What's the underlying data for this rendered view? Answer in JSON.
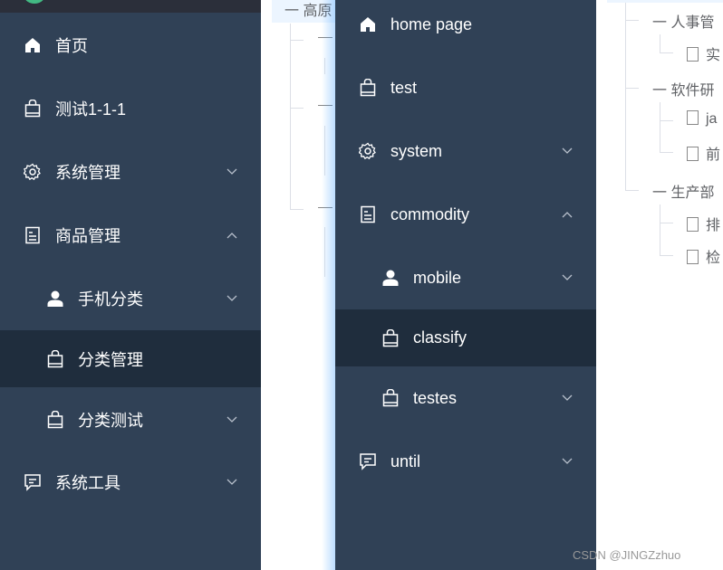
{
  "left_menu": {
    "items": [
      {
        "label": "首页",
        "icon": "home-icon"
      },
      {
        "label": "测试1-1-1",
        "icon": "shopping-bag-icon"
      },
      {
        "label": "系统管理",
        "icon": "gear-icon",
        "chevron": "down"
      },
      {
        "label": "商品管理",
        "icon": "document-icon",
        "chevron": "up"
      },
      {
        "label": "手机分类",
        "icon": "user-icon",
        "chevron": "down"
      },
      {
        "label": "分类管理",
        "icon": "shopping-bag-icon",
        "active": true
      },
      {
        "label": "分类测试",
        "icon": "shopping-bag-icon",
        "chevron": "down"
      },
      {
        "label": "系统工具",
        "icon": "message-icon",
        "chevron": "down"
      }
    ]
  },
  "right_menu": {
    "items": [
      {
        "label": "home page",
        "icon": "home-icon"
      },
      {
        "label": "test",
        "icon": "shopping-bag-icon"
      },
      {
        "label": "system",
        "icon": "gear-icon",
        "chevron": "down"
      },
      {
        "label": "commodity",
        "icon": "document-icon",
        "chevron": "up"
      },
      {
        "label": "mobile",
        "icon": "user-icon",
        "chevron": "down"
      },
      {
        "label": "classify",
        "icon": "shopping-bag-icon",
        "active": true
      },
      {
        "label": "testes",
        "icon": "shopping-bag-icon",
        "chevron": "down"
      },
      {
        "label": "until",
        "icon": "message-icon",
        "chevron": "down"
      }
    ]
  },
  "tree_left": {
    "root": "高原"
  },
  "tree_right": {
    "nodes": [
      "人事管",
      "实",
      "软件研",
      "ja",
      "前",
      "生产部",
      "排",
      "检"
    ]
  },
  "colors": {
    "sidebar": "#304156",
    "active": "#1f2d3d",
    "header": "#2b2f3a",
    "highlight": "#ecf5ff"
  },
  "watermark": "CSDN @JINGZzhuo"
}
